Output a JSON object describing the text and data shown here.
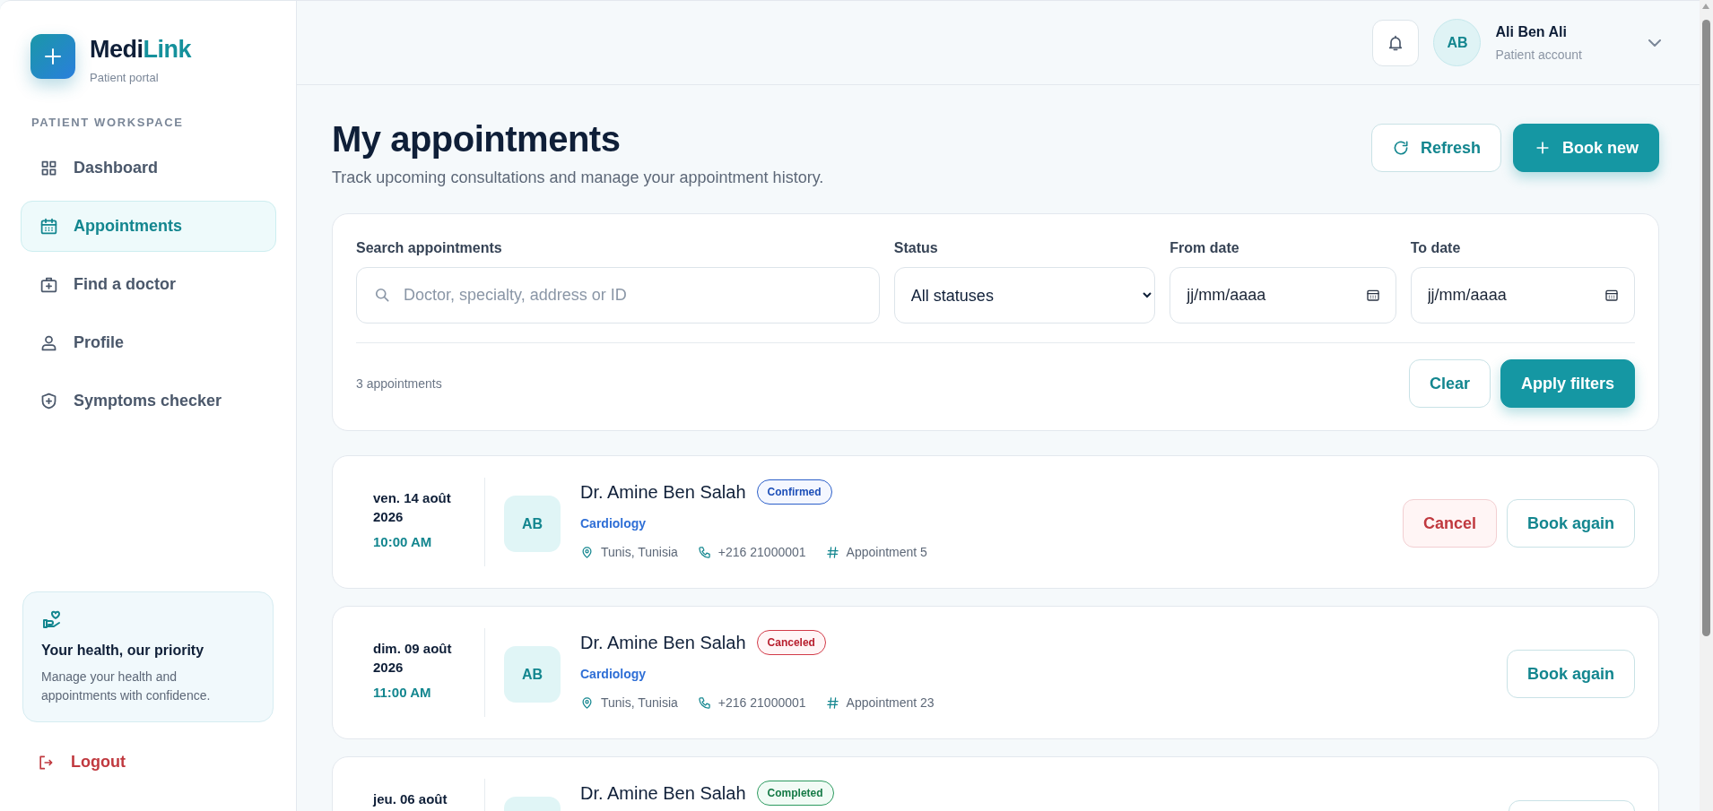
{
  "brand": {
    "name_start": "Medi",
    "name_end": "Link",
    "tagline": "Patient portal"
  },
  "sidebar": {
    "section_title": "PATIENT WORKSPACE",
    "items": [
      {
        "label": "Dashboard",
        "selected": false
      },
      {
        "label": "Appointments",
        "selected": true
      },
      {
        "label": "Find a doctor",
        "selected": false
      },
      {
        "label": "Profile",
        "selected": false
      },
      {
        "label": "Symptoms checker",
        "selected": false
      }
    ],
    "promo": {
      "title": "Your health, our priority",
      "text": "Manage your health and appointments with confidence."
    },
    "logout": "Logout"
  },
  "header": {
    "user": {
      "initials": "AB",
      "name": "Ali Ben Ali",
      "role": "Patient account"
    }
  },
  "page": {
    "title": "My appointments",
    "subtitle": "Track upcoming consultations and manage your appointment history.",
    "actions": [
      {
        "label": "Refresh",
        "kind": "secondary"
      },
      {
        "label": "Book new",
        "kind": "primary"
      }
    ]
  },
  "filters": {
    "fields": [
      {
        "kind": "search",
        "label": "Search appointments",
        "placeholder": "Doctor, specialty, address or ID"
      },
      {
        "kind": "select",
        "label": "Status",
        "value": "All statuses"
      },
      {
        "kind": "date",
        "label": "From date",
        "placeholder": "jj/mm/aaaa"
      },
      {
        "kind": "date",
        "label": "To date",
        "placeholder": "jj/mm/aaaa"
      }
    ],
    "count": "3 appointments",
    "buttons": [
      {
        "label": "Clear",
        "kind": "secondary"
      },
      {
        "label": "Apply filters",
        "kind": "primary"
      }
    ]
  },
  "appointments": [
    {
      "date": "ven. 14 août 2026",
      "time": "10:00 AM",
      "initials": "AB",
      "doctor": "Dr. Amine Ben Salah",
      "status": {
        "label": "Confirmed",
        "kind": "confirmed"
      },
      "specialty": "Cardiology",
      "meta": [
        {
          "kind": "location",
          "text": "Tunis, Tunisia"
        },
        {
          "kind": "phone",
          "text": "+216 21000001"
        },
        {
          "kind": "id",
          "text": "Appointment 5"
        }
      ],
      "actions": [
        {
          "kind": "cancel",
          "label": "Cancel"
        },
        {
          "kind": "rebook",
          "label": "Book again"
        }
      ]
    },
    {
      "date": "dim. 09 août 2026",
      "time": "11:00 AM",
      "initials": "AB",
      "doctor": "Dr. Amine Ben Salah",
      "status": {
        "label": "Canceled",
        "kind": "canceled"
      },
      "specialty": "Cardiology",
      "meta": [
        {
          "kind": "location",
          "text": "Tunis, Tunisia"
        },
        {
          "kind": "phone",
          "text": "+216 21000001"
        },
        {
          "kind": "id",
          "text": "Appointment 23"
        }
      ],
      "actions": [
        {
          "kind": "rebook",
          "label": "Book again"
        }
      ]
    },
    {
      "date": "jeu. 06 août",
      "doctor": "Dr. Amine Ben Salah",
      "status": {
        "label": "Completed",
        "kind": "completed"
      },
      "actions": [
        {
          "kind": "rebook"
        }
      ]
    }
  ]
}
